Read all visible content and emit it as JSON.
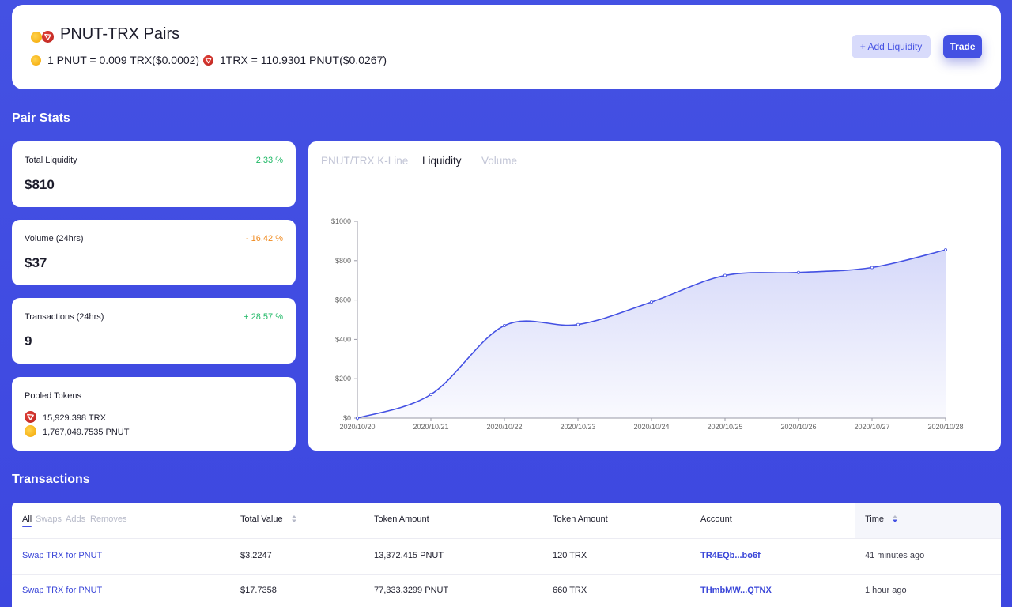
{
  "header": {
    "title": "PNUT-TRX Pairs",
    "rate1": "1 PNUT = 0.009 TRX($0.0002)",
    "rate2": "1TRX = 110.9301 PNUT($0.0267)",
    "add_liquidity_label": "+ Add Liquidity",
    "trade_label": "Trade"
  },
  "pair_stats": {
    "title": "Pair Stats",
    "total_liquidity": {
      "label": "Total Liquidity",
      "change": "+ 2.33 %",
      "value": "$810"
    },
    "volume": {
      "label": "Volume (24hrs)",
      "change": "- 16.42 %",
      "value": "$37"
    },
    "transactions": {
      "label": "Transactions (24hrs)",
      "change": "+ 28.57 %",
      "value": "9"
    },
    "pooled_tokens": {
      "label": "Pooled Tokens",
      "trx": "15,929.398 TRX",
      "pnut": "1,767,049.7535 PNUT"
    }
  },
  "chart_tabs": {
    "kline": "PNUT/TRX K-Line",
    "liquidity": "Liquidity",
    "volume": "Volume"
  },
  "chart_data": {
    "type": "area",
    "title": "",
    "xlabel": "",
    "ylabel": "",
    "x": [
      "2020/10/20",
      "2020/10/21",
      "2020/10/22",
      "2020/10/23",
      "2020/10/24",
      "2020/10/25",
      "2020/10/26",
      "2020/10/27",
      "2020/10/28"
    ],
    "values": [
      0,
      120,
      470,
      475,
      590,
      725,
      740,
      765,
      855
    ],
    "ylim": [
      0,
      1000
    ],
    "yticks": [
      "$0",
      "$200",
      "$400",
      "$600",
      "$800",
      "$1000"
    ],
    "grid": false,
    "color": "#4451e3"
  },
  "transactions": {
    "title": "Transactions",
    "filters": {
      "all": "All",
      "swaps": "Swaps",
      "adds": "Adds",
      "removes": "Removes"
    },
    "columns": {
      "total_value": "Total Value",
      "token_amount_1": "Token Amount",
      "token_amount_2": "Token Amount",
      "account": "Account",
      "time": "Time"
    },
    "rows": [
      {
        "type": "Swap TRX for PNUT",
        "total_value": "$3.2247",
        "amount1": "13,372.415 PNUT",
        "amount2": "120 TRX",
        "account": "TR4EQb...bo6f",
        "time": "41 minutes ago"
      },
      {
        "type": "Swap TRX for PNUT",
        "total_value": "$17.7358",
        "amount1": "77,333.3299 PNUT",
        "amount2": "660 TRX",
        "account": "THmbMW...QTNX",
        "time": "1 hour ago"
      }
    ]
  },
  "icons": {
    "pnut": "pnut-token-icon",
    "trx": "trx-token-icon",
    "sort": "sort-icon"
  },
  "colors": {
    "accent": "#4451e3",
    "positive": "#1fb865",
    "negative": "#f08a1e"
  }
}
